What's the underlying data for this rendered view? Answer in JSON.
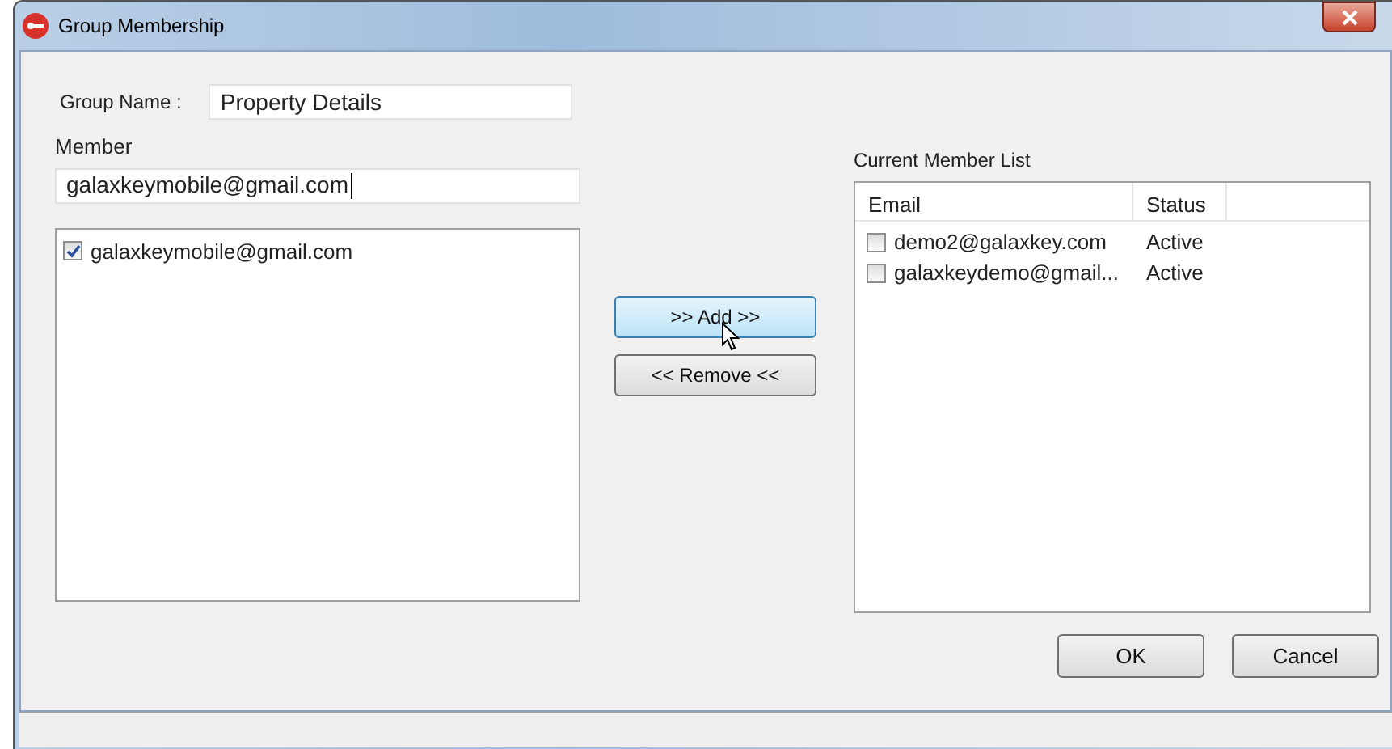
{
  "window": {
    "title": "Group Membership"
  },
  "group_name": {
    "label": "Group Name :",
    "value": "Property Details"
  },
  "member": {
    "label": "Member",
    "value": "galaxkeymobile@gmail.com",
    "results": [
      {
        "email": "galaxkeymobile@gmail.com",
        "checked": true
      }
    ]
  },
  "buttons": [
    {
      "label": ">> Add >>",
      "hovered": true
    },
    {
      "label": "<< Remove <<",
      "hovered": false
    }
  ],
  "current_members": {
    "label": "Current Member List",
    "columns": [
      "Email",
      "Status"
    ],
    "rows": [
      {
        "email": "demo2@galaxkey.com",
        "status": "Active",
        "checked": false
      },
      {
        "email": "galaxkeydemo@gmail...",
        "status": "Active",
        "checked": false
      }
    ]
  },
  "dialog_buttons": [
    "OK",
    "Cancel"
  ]
}
